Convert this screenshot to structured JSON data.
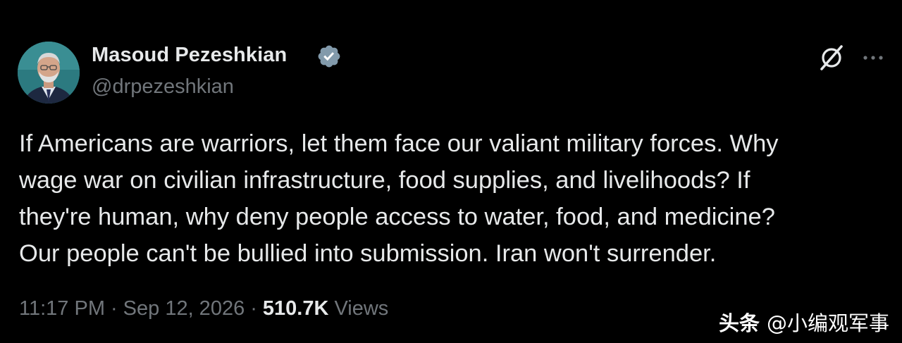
{
  "author": {
    "display_name": "Masoud Pezeshkian",
    "handle": "@drpezeshkian",
    "verified": true,
    "verified_color": "#829aab"
  },
  "toolbar": {
    "grok_icon": "grok-slash-circle-icon",
    "more_icon": "more-dots-icon"
  },
  "tweet": {
    "lines": [
      "If Americans are warriors, let them face our valiant military forces. Why",
      "wage war on civilian infrastructure, food supplies, and livelihoods? If",
      "they're human, why deny people access to water, food, and medicine?",
      "Our people can't be bullied into submission. Iran won't surrender."
    ]
  },
  "meta": {
    "time": "11:17 PM",
    "separator": "·",
    "date": "Sep 12, 2026",
    "views_count": "510.7K",
    "views_label": "Views"
  },
  "watermark": {
    "brand": "头条",
    "account": "@小编观军事"
  },
  "colors": {
    "background": "#000000",
    "primary_text": "#e7e9ea",
    "secondary_text": "#71767b"
  }
}
